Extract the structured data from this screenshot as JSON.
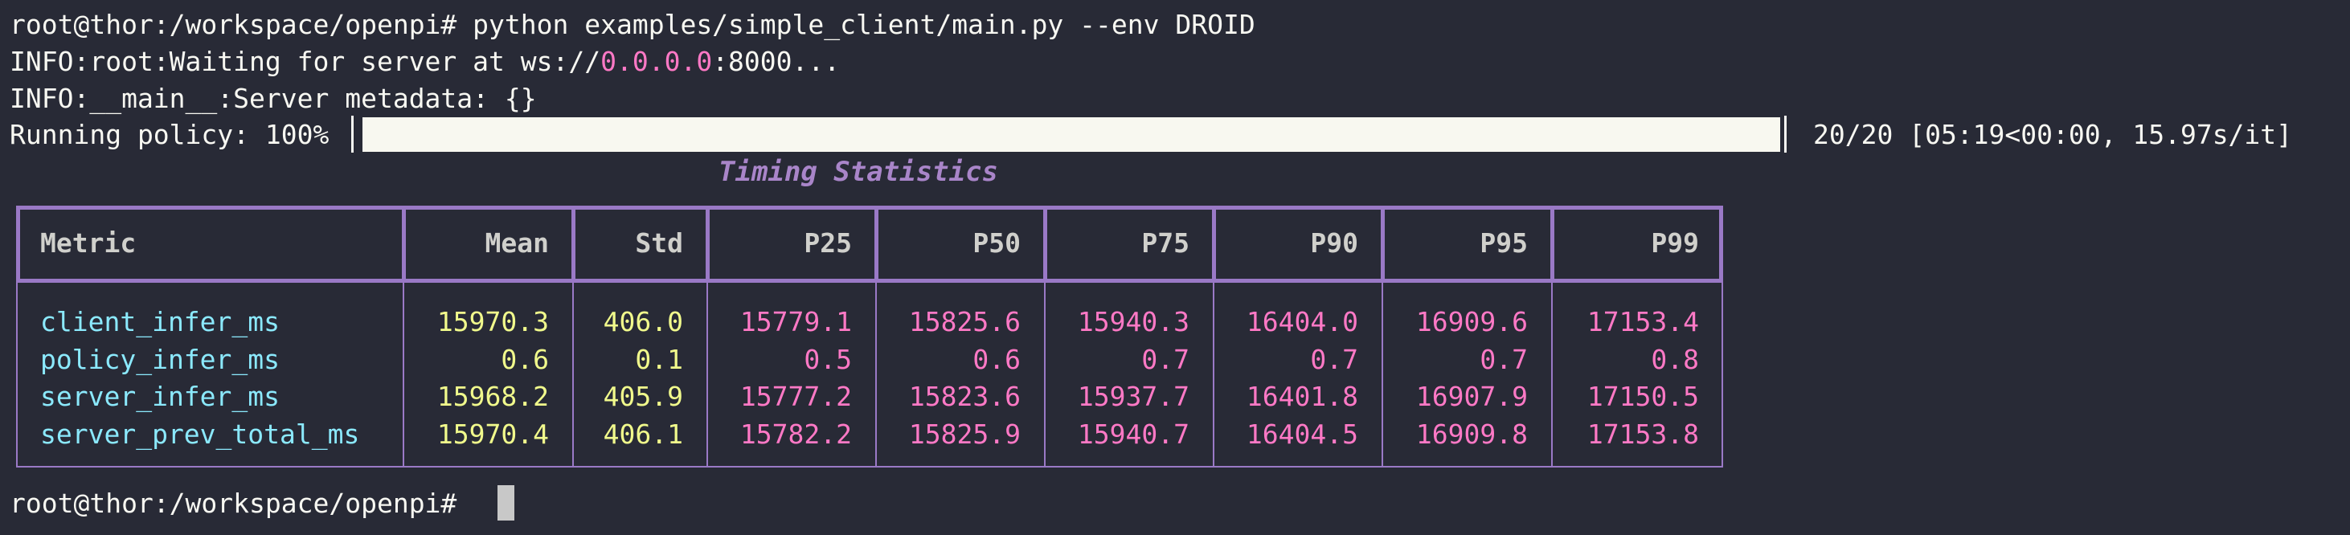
{
  "terminal": {
    "lines": {
      "cmd_prompt": "root@thor:/workspace/openpi# ",
      "cmd_text": "python examples/simple_client/main.py --env DROID",
      "wait_prefix": "INFO:root:Waiting for server at ws://",
      "wait_host": "0.0.0.0",
      "wait_suffix": ":8000...",
      "metadata": "INFO:__main__:Server metadata: {}",
      "progress_label": "Running policy: 100%",
      "progress_status": "20/20 [05:19<00:00, 15.97s/it]",
      "final_prompt": "root@thor:/workspace/openpi# "
    },
    "progress": {
      "fraction": 1.0
    }
  },
  "table": {
    "title": "Timing Statistics",
    "headers": [
      "Metric",
      "Mean",
      "Std",
      "P25",
      "P50",
      "P75",
      "P90",
      "P95",
      "P99"
    ],
    "rows": [
      {
        "metric": "client_infer_ms",
        "mean": "15970.3",
        "std": "406.0",
        "p25": "15779.1",
        "p50": "15825.6",
        "p75": "15940.3",
        "p90": "16404.0",
        "p95": "16909.6",
        "p99": "17153.4"
      },
      {
        "metric": "policy_infer_ms",
        "mean": "0.6",
        "std": "0.1",
        "p25": "0.5",
        "p50": "0.6",
        "p75": "0.7",
        "p90": "0.7",
        "p95": "0.7",
        "p99": "0.8"
      },
      {
        "metric": "server_infer_ms",
        "mean": "15968.2",
        "std": "405.9",
        "p25": "15777.2",
        "p50": "15823.6",
        "p75": "15937.7",
        "p90": "16401.8",
        "p95": "16907.9",
        "p99": "17150.5"
      },
      {
        "metric": "server_prev_total_ms",
        "mean": "15970.4",
        "std": "406.1",
        "p25": "15782.2",
        "p50": "15825.9",
        "p75": "15940.7",
        "p90": "16404.5",
        "p95": "16909.8",
        "p99": "17153.8"
      }
    ]
  },
  "colors": {
    "background": "#282a36",
    "foreground": "#f8f8f2",
    "metric_name": "#8be9fd",
    "mean_std": "#f1fa8c",
    "percentile": "#ff79c6",
    "table_border": "#9a79c6",
    "title": "#a985c9"
  }
}
